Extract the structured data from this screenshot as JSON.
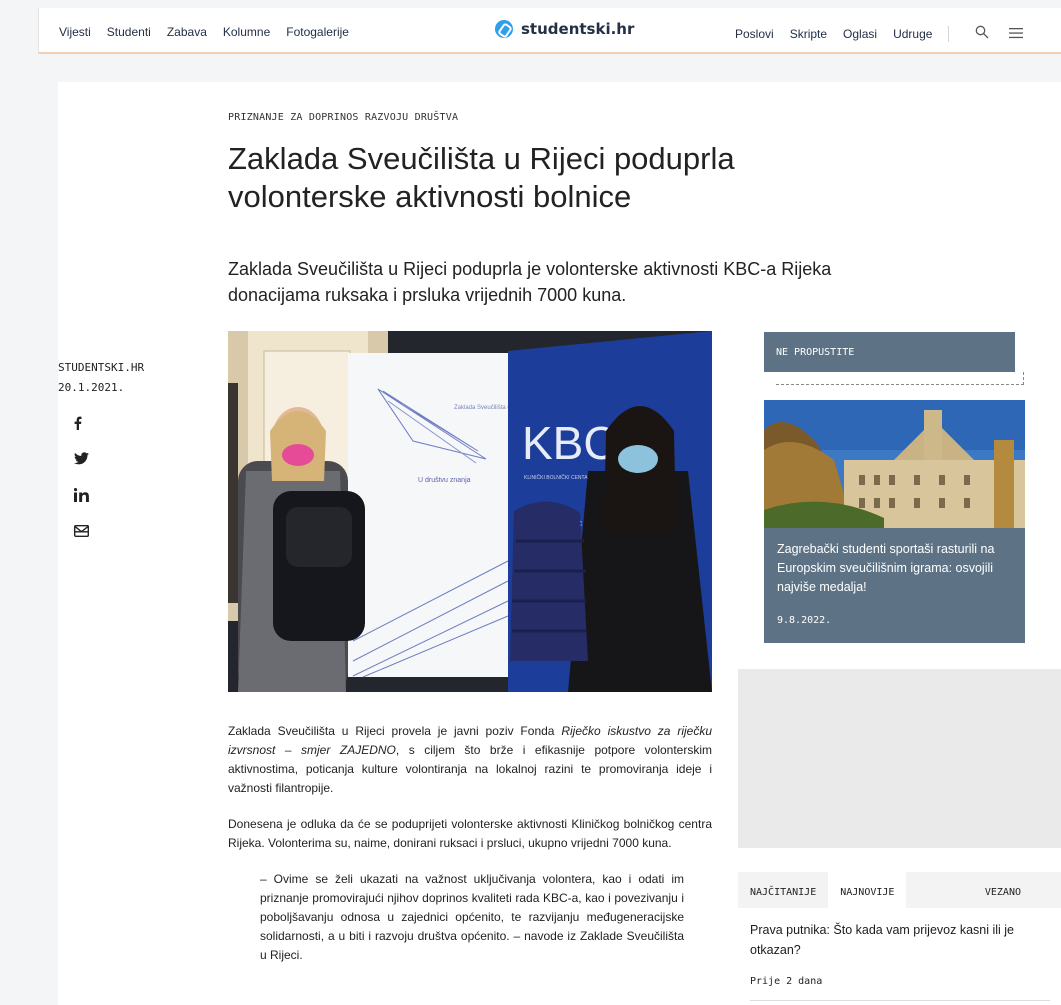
{
  "nav": {
    "left": [
      "Vijesti",
      "Studenti",
      "Zabava",
      "Kolumne",
      "Fotogalerije"
    ],
    "right": [
      "Poslovi",
      "Skripte",
      "Oglasi",
      "Udruge"
    ],
    "logo": "studentski.hr",
    "icons": [
      "search-icon",
      "menu-icon"
    ]
  },
  "article": {
    "kicker": "PRIZNANJE ZA DOPRINOS RAZVOJU DRUŠTVA",
    "title": "Zaklada Sveučilišta u Rijeci poduprla volonterske aktivnosti bolnice",
    "lead": "Zaklada Sveučilišta u Rijeci poduprla je volonterske aktivnosti KBC-a Rijeka donacijama ruksaka i prsluka vrijednih 7000 kuna.",
    "author": "STUDENTSKI.HR",
    "date": "20.1.2021.",
    "share": [
      "facebook-icon",
      "twitter-icon",
      "linkedin-icon",
      "email-icon"
    ],
    "photo_texts": {
      "banner_title": "Zaklada Sveučilišta u Rijeci",
      "banner_tagline": "U društvu znanja",
      "kbc": "KBC",
      "kbc_sub": "KLINIČKI BOLNIČKI CENTAR",
      "kbc_small": "kbc"
    },
    "p1_pre": "Zaklada Sveučilišta u Rijeci provela je javni poziv Fonda ",
    "p1_italic": "Riječko iskustvo za riječku izvrsnost – smjer ZAJEDNO",
    "p1_post": ", s ciljem što brže i efikasnije potpore volonterskim aktivnostima, poticanja kulture volontiranja na lokalnoj razini te promoviranja ideje i važnosti filantropije.",
    "p2": "Donesena je odluka da će se poduprijeti volonterske aktivnosti Kliničkog bolničkog centra Rijeka. Volonterima su, naime, donirani ruksaci i prsluci, ukupno vrijedni 7000 kuna.",
    "quote": "– Ovime se želi ukazati na važnost uključivanja volontera, kao i odati im priznanje promovirajući njihov doprinos kvaliteti rada KBC-a, kao i povezivanju i poboljšavanju odnosa u zajednici općenito, te razvijanju međugeneracijske solidarnosti, a u biti i razvoju društva općenito. – navode iz Zaklade Sveučilišta u Rijeci."
  },
  "sidebar": {
    "np_label": "NE PROPUSTITE",
    "np_title": "Zagrebački studenti sportaši rasturili na Europskim sveučilišnim igrama: osvojili najviše medalja!",
    "np_date": "9.8.2022.",
    "tabs": [
      "NAJČITANIJE",
      "NAJNOVIJE",
      "VEZANO"
    ],
    "popular_title": "Prava putnika: Što kada vam prijevoz kasni ili je otkazan?",
    "popular_date": "Prije 2 dana"
  },
  "colors": {
    "accent_line": "#f6cdb3",
    "card_blue": "#5d7385",
    "logo_blue": "#2f9fea"
  }
}
